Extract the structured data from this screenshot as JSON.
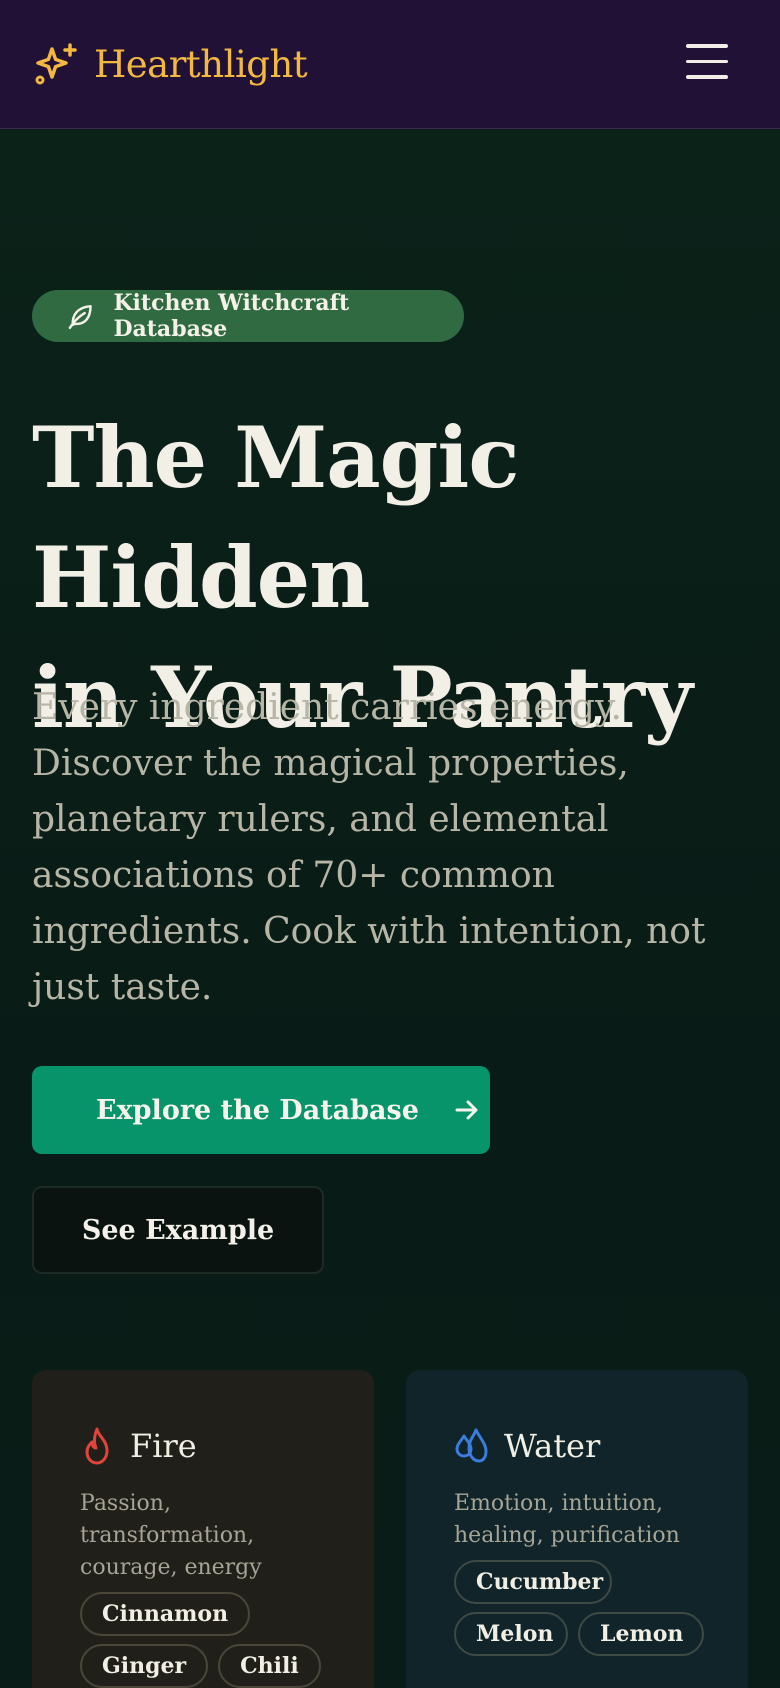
{
  "nav": {
    "brand": "Hearthlight",
    "brand_color": "#f3b83f",
    "menu_icon": "hamburger-menu-icon"
  },
  "hero": {
    "badge": {
      "icon": "leaf-icon",
      "label": "Kitchen Witchcraft Database"
    },
    "headline_line1": "The Magic Hidden",
    "headline_line2": "in Your Pantry",
    "lede": "Every ingredient carries energy. Discover the magical properties, planetary rulers, and elemental associations of 70+ common ingredients. Cook with intention, not just taste.",
    "primary_button": "Explore the Database",
    "secondary_button": "See Example"
  },
  "elements": [
    {
      "name": "Fire",
      "icon": "flame-icon",
      "color": "#e0453a",
      "description": "Passion, transformation, courage, energy",
      "chips": [
        "Cinnamon",
        "Ginger",
        "Chili"
      ]
    },
    {
      "name": "Water",
      "icon": "droplets-icon",
      "color": "#3b7ddd",
      "description": "Emotion, intuition, healing, purification",
      "chips": [
        "Cucumber",
        "Melon",
        "Lemon"
      ]
    }
  ],
  "colors": {
    "nav_bg": "#211137",
    "page_bg": "#0b1e18",
    "badge_bg": "#2f6a40",
    "primary_button_bg": "#07946a"
  }
}
